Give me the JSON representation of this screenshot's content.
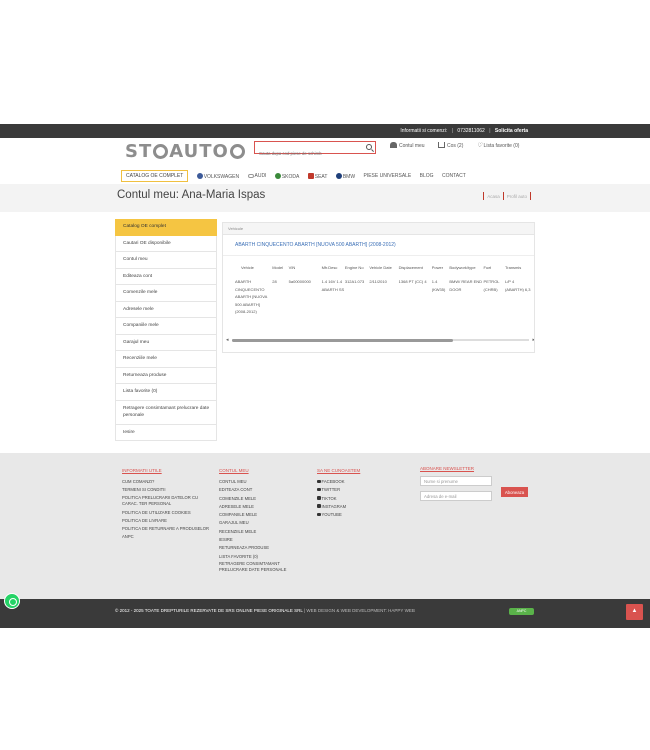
{
  "topbar": {
    "info": "Informatii si comenzi:",
    "phone": "0732811062",
    "offer": "Solicita oferta"
  },
  "header": {
    "logo": "ST AUTO",
    "search_placeholder": "Cauta dupa cod piese de schimb",
    "account": "Contul meu",
    "cart": "Cos (2)",
    "favorites": "Lista favorite (0)"
  },
  "nav": {
    "items": [
      "CATALOG OE COMPLET",
      "VOLKSWAGEN",
      "AUDI",
      "SKODA",
      "SEAT",
      "BMW",
      "PIESE UNIVERSALE",
      "BLOG",
      "CONTACT"
    ]
  },
  "page": {
    "title": "Contul meu: Ana-Maria Ispas",
    "breadcrumb": [
      "Acasa",
      "Profil auto"
    ]
  },
  "sidebar": {
    "items": [
      "Catalog OE complet",
      "Cautari OE disponibile",
      "Contul meu",
      "Editeaza cont",
      "Comenzile mele",
      "Adresele mele",
      "Companiile mele",
      "Garajul meu",
      "Recenziile mele",
      "Returneaza produse",
      "Lista favorite (0)",
      "Retragere consimtamant prelucrare date personale",
      "Iesire"
    ]
  },
  "vehicles": {
    "tab": "Vehicule",
    "title": "ABARTH CINQUECENTO ABARTH [NUOVA 500 ABARTH] (2008-2012)",
    "columns": [
      "Vehicle",
      "Model",
      "VIN",
      "Mfr.Desc",
      "Engine No",
      "Vehicle Date",
      "Displacement",
      "Power",
      "Bodywork/type",
      "Fuel",
      "Transmis"
    ],
    "row": [
      "ABARTH CINQUECENTO ABARTH [NUOVA 500 ABARTH] (2008-2012)",
      "28",
      "5a00000000",
      "1.4 16V 1.4 ABARTH SS",
      "312A1.073",
      "2/11/2010",
      "1368 PT (CC) 4",
      "1.4 (KW35)",
      "BMW/ REAR END DOOR",
      "PETROL (CHRB)",
      "L/P 4 (ABARTH) 6,3"
    ]
  },
  "footer": {
    "info_title": "INFORMATII UTILE",
    "info_links": [
      "CUM COMANZI?",
      "TERMENI SI CONDITII",
      "POLITICA PRELUCRARII DATELOR CU CARAC. TER PERSONAL",
      "POLITICA DE UTILIZARE COOKIES",
      "POLITICA DE LIVRARE",
      "POLITICA DE RETURNARE A PRODUSELOR",
      "ANPC"
    ],
    "account_title": "CONTUL MEU",
    "account_links": [
      "CONTUL MEU",
      "EDITEAZA CONT",
      "COMENZILE MELE",
      "ADRESELE MELE",
      "COMPANIILE MELE",
      "GARAJUL MEU",
      "RECENZIILE MELE",
      "IESIRE",
      "RETURNEAZA PRODUSE",
      "LISTA FAVORITE (0)",
      "RETRAGERE CONSIMTAMANT PRELUCRARE DATE PERSONALE"
    ],
    "social_title": "SA NE CUNOASTEM",
    "social_links": [
      "FACEBOOK",
      "TWITTER",
      "TIKTOK",
      "INSTAGRAM",
      "YOUTUBE"
    ],
    "newsletter_title": "ABONARE NEWSLETTER",
    "name_placeholder": "Nume si prenume",
    "email_placeholder": "Adresa de e-mail",
    "subscribe": "Aboneaza"
  },
  "bottom": {
    "copyright": "© 2012 - 2025 TOATE DREPTURILE REZERVATE DE SRS ONLINE PIESE ORIGINALE SRL",
    "credits": "| WEB DESIGN & WEB DEVELOPMENT: HAPPY WEB",
    "badge": "ANPC"
  },
  "colors": {
    "accent": "#d9534f",
    "highlight": "#f5c542",
    "dark": "#3a3a3a"
  }
}
